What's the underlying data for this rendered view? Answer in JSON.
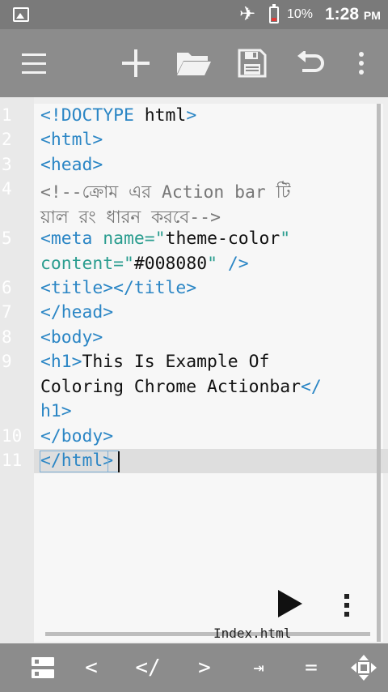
{
  "status_bar": {
    "battery_percent": "10%",
    "time": "1:28",
    "ampm": "PM",
    "icons": [
      "gallery-icon",
      "airplane-icon",
      "battery-low-icon"
    ]
  },
  "toolbar": {
    "icons": [
      "menu-icon",
      "add-icon",
      "folder-open-icon",
      "save-icon",
      "undo-icon",
      "more-vert-icon"
    ]
  },
  "editor": {
    "line_numbers": [
      "1",
      "2",
      "3",
      "4",
      "5",
      "6",
      "7",
      "8",
      "9",
      "10",
      "11"
    ],
    "lines": {
      "l1": {
        "t1": "<!DOCTYPE",
        "t2": " html",
        "t3": ">"
      },
      "l2": "<html>",
      "l3": "<head>",
      "l4a": "<!--ক্রোম এর Action bar টি",
      "l4b": "য়াল রং ধারন করবে-->",
      "l5a": {
        "t1": "<meta ",
        "t2": "name=",
        "t3": "\"",
        "t4": "theme-color",
        "t5": "\""
      },
      "l5b": {
        "t1": "content=",
        "t2": "\"",
        "t3": "#008080",
        "t4": "\"",
        "t5": " />"
      },
      "l6": "<title></title>",
      "l7": "</head>",
      "l8": "<body>",
      "l9a": {
        "t1": "<h1>",
        "t2": "This Is Example Of"
      },
      "l9b": {
        "t1": "Coloring Chrome Actionbar",
        "t2": "</"
      },
      "l9c": "h1>",
      "l10": "</body>",
      "l11": "</html>"
    },
    "current_line": 11,
    "filename": "Index.html",
    "run_icon": "play-icon"
  },
  "bottom_bar": {
    "lt": "<",
    "close_tag": "</",
    "gt": ">",
    "tab": "→|",
    "tab_display": "⇥",
    "equals": "=",
    "icons": [
      "list-icon",
      "move-icon"
    ]
  }
}
